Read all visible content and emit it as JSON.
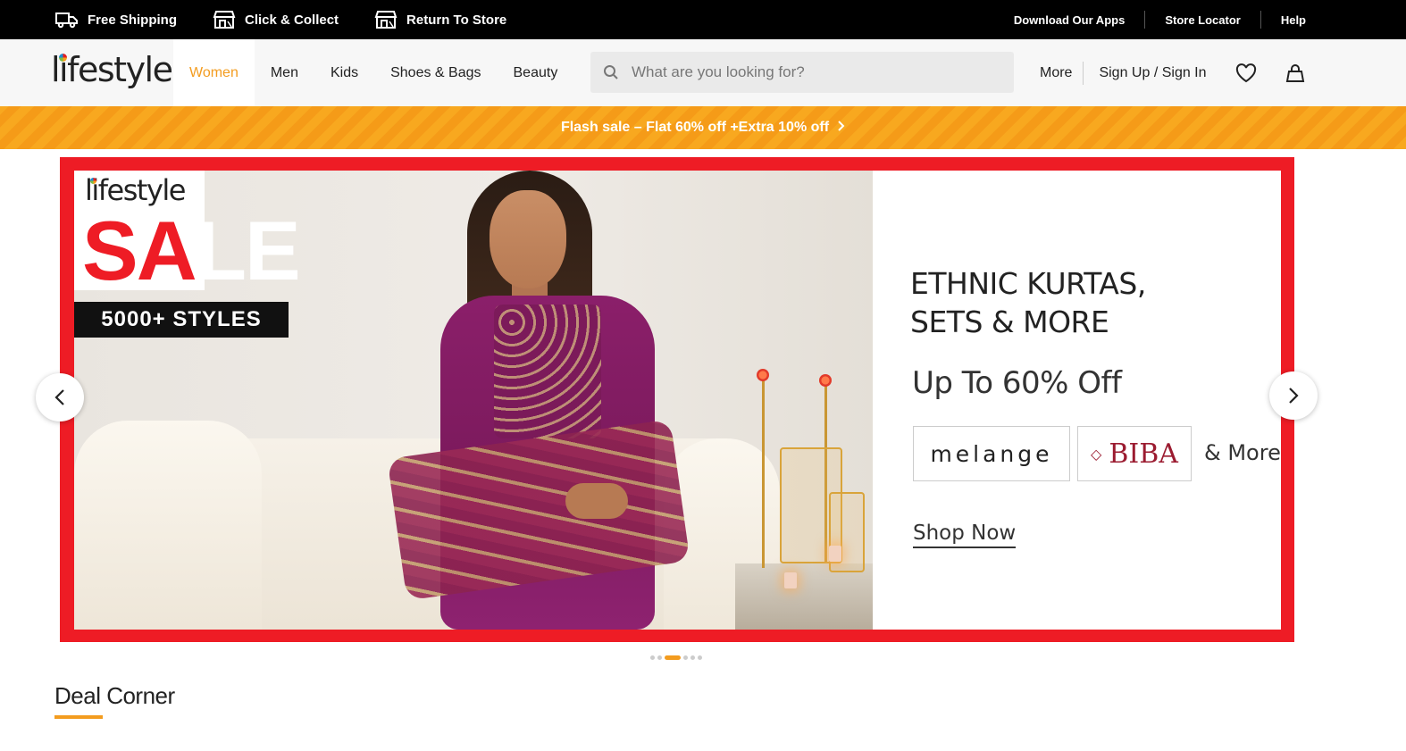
{
  "topbar": {
    "utilities": [
      {
        "label": "Free Shipping",
        "icon": "truck-icon"
      },
      {
        "label": "Click & Collect",
        "icon": "store-pickup-icon"
      },
      {
        "label": "Return To Store",
        "icon": "store-return-icon"
      }
    ],
    "links": [
      "Download Our Apps",
      "Store Locator",
      "Help"
    ]
  },
  "header": {
    "logo": "lifestyle",
    "nav": [
      "Women",
      "Men",
      "Kids",
      "Shoes & Bags",
      "Beauty"
    ],
    "active_nav": "Women",
    "search_placeholder": "What are you looking for?",
    "more_label": "More",
    "signin_label": "Sign Up / Sign In",
    "icons": [
      "heart-icon",
      "bag-icon"
    ]
  },
  "flash_banner": {
    "text": "Flash sale – Flat 60% off +Extra 10% off"
  },
  "hero": {
    "badge_logo": "lifestyle",
    "sale_red": "SA",
    "sale_white": "LE",
    "styles_text": "5000+ STYLES",
    "headline_line1": "ETHNIC KURTAS,",
    "headline_line2": "SETS & MORE",
    "offer": "Up To 60% Off",
    "brand1": "melange",
    "brand2": "BIBA",
    "and_more": "& More",
    "cta": "Shop Now",
    "colors": {
      "frame": "#ee1c25",
      "accent": "#f39c1f"
    },
    "slide_count": 6,
    "active_slide": 3
  },
  "section": {
    "title": "Deal Corner"
  }
}
